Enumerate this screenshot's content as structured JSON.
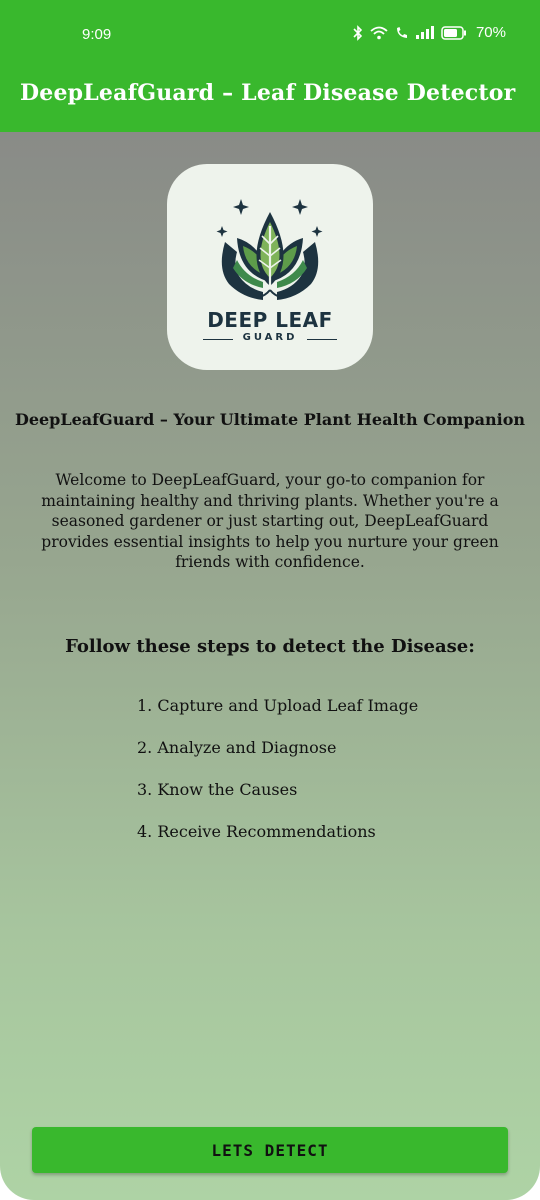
{
  "status_bar": {
    "time": "9:09",
    "battery": "70%",
    "icons": [
      "bluetooth-icon",
      "wifi-icon",
      "wifi-calling-icon",
      "signal-icon",
      "battery-icon"
    ]
  },
  "app_bar": {
    "title": "DeepLeafGuard – Leaf Disease Detector",
    "color": "#39b82d"
  },
  "logo": {
    "main_text": "DEEP LEAF",
    "sub_text": "GUARD"
  },
  "headline": "DeepLeafGuard – Your Ultimate Plant Health Companion",
  "welcome": "Welcome to DeepLeafGuard, your go-to companion for maintaining healthy and thriving plants. Whether you're a seasoned gardener or just starting out, DeepLeafGuard provides essential insights to help you nurture your green friends with confidence.",
  "steps_title": "Follow these steps to detect the Disease:",
  "steps": [
    "1. Capture and Upload Leaf Image",
    "2. Analyze and Diagnose",
    "3. Know the Causes",
    "4. Receive Recommendations"
  ],
  "detect_button": "LETS DETECT"
}
